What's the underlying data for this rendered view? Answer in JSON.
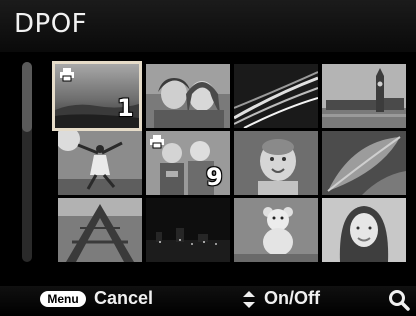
{
  "header": {
    "title": "DPOF"
  },
  "thumbnails": [
    {
      "id": "photo-1",
      "print_count": "1",
      "print_marked": true,
      "selected": true
    },
    {
      "id": "photo-2",
      "print_count": "",
      "print_marked": false,
      "selected": false
    },
    {
      "id": "photo-3",
      "print_count": "",
      "print_marked": false,
      "selected": false
    },
    {
      "id": "photo-4",
      "print_count": "",
      "print_marked": false,
      "selected": false
    },
    {
      "id": "photo-5",
      "print_count": "",
      "print_marked": false,
      "selected": false
    },
    {
      "id": "photo-6",
      "print_count": "9",
      "print_marked": true,
      "selected": false
    },
    {
      "id": "photo-7",
      "print_count": "",
      "print_marked": false,
      "selected": false
    },
    {
      "id": "photo-8",
      "print_count": "",
      "print_marked": false,
      "selected": false
    },
    {
      "id": "photo-9",
      "print_count": "",
      "print_marked": false,
      "selected": false
    },
    {
      "id": "photo-10",
      "print_count": "",
      "print_marked": false,
      "selected": false
    },
    {
      "id": "photo-11",
      "print_count": "",
      "print_marked": false,
      "selected": false
    },
    {
      "id": "photo-12",
      "print_count": "",
      "print_marked": false,
      "selected": false
    }
  ],
  "footer": {
    "menu_key": "Menu",
    "cancel_label": "Cancel",
    "onoff_label": "On/Off",
    "updown_icon": "up-down-arrows-icon",
    "zoom_icon": "magnifier-icon"
  },
  "colors": {
    "selection_border": "#e6dcc9",
    "background": "#000000"
  }
}
